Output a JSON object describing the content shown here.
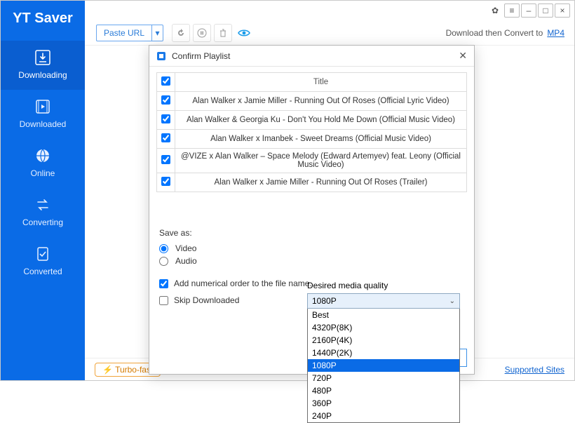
{
  "app": {
    "name": "YT Saver"
  },
  "titlebar": {
    "settings": "gear",
    "menu": "menu",
    "min": "–",
    "max": "□",
    "close": "×"
  },
  "toolbar": {
    "paste_label": "Paste URL",
    "paste_caret": "▾",
    "undo_icon": "↺",
    "pause_icon": "⏸",
    "trash_icon": "🗑",
    "eye_icon": "👁",
    "convert_text": "Download then Convert to",
    "convert_format": "MP4"
  },
  "sidebar": {
    "items": [
      {
        "label": "Downloading"
      },
      {
        "label": "Downloaded"
      },
      {
        "label": "Online"
      },
      {
        "label": "Converting"
      },
      {
        "label": "Converted"
      }
    ]
  },
  "footer": {
    "turbo": "Turbo-fast",
    "support": "Supported Sites"
  },
  "dialog": {
    "title": "Confirm Playlist",
    "col_title": "Title",
    "rows": [
      {
        "title": "Alan Walker x Jamie Miller - Running Out Of Roses (Official Lyric Video)"
      },
      {
        "title": "Alan Walker & Georgia Ku - Don't You Hold Me Down (Official Music Video)"
      },
      {
        "title": "Alan Walker x Imanbek - Sweet Dreams (Official Music Video)"
      },
      {
        "title": "@VIZE  x Alan Walker – Space Melody (Edward Artemyev) feat. Leony (Official Music Video)"
      },
      {
        "title": "Alan Walker x Jamie Miller - Running Out Of Roses (Trailer)"
      }
    ],
    "save_as_label": "Save as:",
    "radio_video": "Video",
    "radio_audio": "Audio",
    "chk_numerical": "Add numerical order to the file name.",
    "chk_skip": "Skip Downloaded",
    "quality_label": "Desired media quality",
    "quality_selected": "1080P",
    "quality_options": [
      "Best",
      "4320P(8K)",
      "2160P(4K)",
      "1440P(2K)",
      "1080P",
      "720P",
      "480P",
      "360P",
      "240P"
    ]
  }
}
